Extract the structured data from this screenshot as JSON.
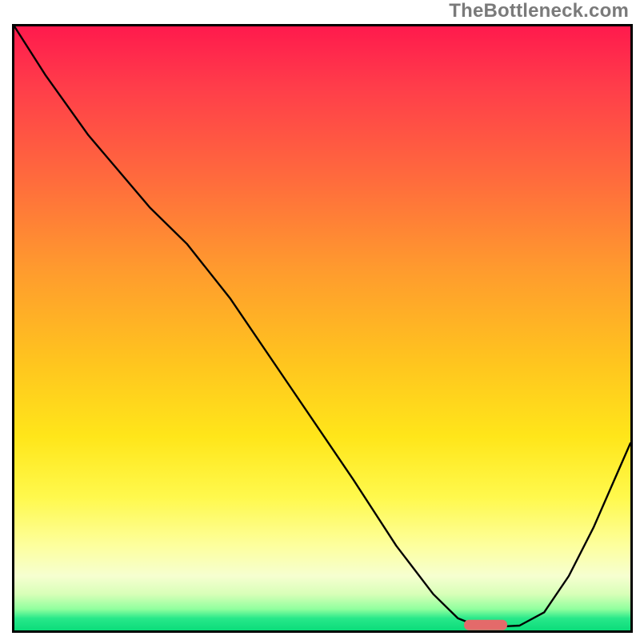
{
  "watermark": "TheBottleneck.com",
  "colors": {
    "gradient_top": "#ff1a4d",
    "gradient_bottom": "#0bdc7a",
    "marker": "#e46a6a",
    "curve": "#000000",
    "border": "#000000"
  },
  "chart_data": {
    "type": "line",
    "title": "",
    "xlabel": "",
    "ylabel": "",
    "xlim": [
      0,
      100
    ],
    "ylim": [
      0,
      100
    ],
    "grid": false,
    "legend": false,
    "series": [
      {
        "name": "bottleneck-curve",
        "x": [
          0,
          5,
          12,
          22,
          28,
          35,
          45,
          55,
          62,
          68,
          72,
          75,
          78,
          82,
          86,
          90,
          94,
          100
        ],
        "y": [
          100,
          92,
          82,
          70,
          64,
          55,
          40,
          25,
          14,
          6,
          2,
          0.8,
          0.6,
          0.8,
          3,
          9,
          17,
          31
        ]
      }
    ],
    "marker": {
      "name": "optimal-range",
      "x_start": 73,
      "x_end": 80,
      "y": 0.9,
      "color": "#e46a6a"
    }
  }
}
